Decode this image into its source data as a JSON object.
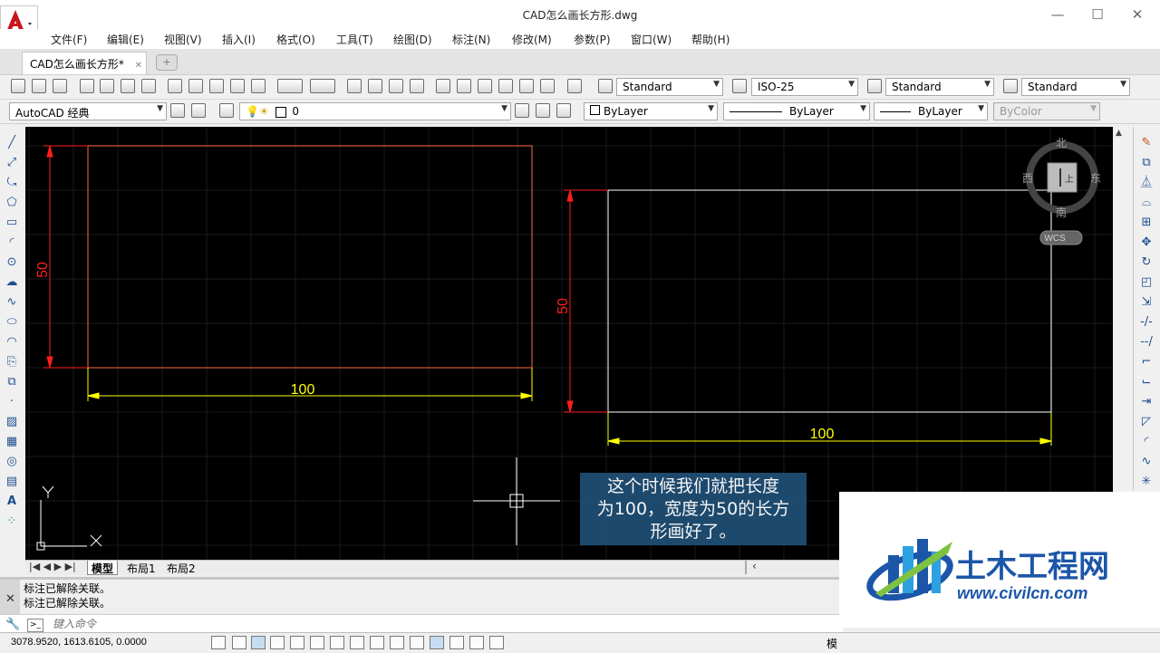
{
  "window": {
    "title": "CAD怎么画长方形.dwg",
    "minimize": "—",
    "maximize": "☐",
    "close": "✕"
  },
  "menu": [
    "文件(F)",
    "编辑(E)",
    "视图(V)",
    "插入(I)",
    "格式(O)",
    "工具(T)",
    "绘图(D)",
    "标注(N)",
    "修改(M)",
    "参数(P)",
    "窗口(W)",
    "帮助(H)"
  ],
  "doc_tab": {
    "label": "CAD怎么画长方形*",
    "close": "✕",
    "new_tab": "+"
  },
  "toolbar": {
    "text_style": "Standard",
    "dim_style": "ISO-25",
    "table_style": "Standard",
    "mleader_style": "Standard",
    "workspace": "AutoCAD 经典",
    "layer": "0",
    "color": "ByLayer",
    "linetype": "ByLayer",
    "lineweight": "ByLayer",
    "plotstyle": "ByColor"
  },
  "drawing": {
    "left_rect": {
      "width_dim": "100",
      "height_dim": "50"
    },
    "right_rect": {
      "width_dim": "100",
      "height_dim": "50"
    },
    "ucs": {
      "y_label": "Y",
      "x_label": "X"
    }
  },
  "viewcube": {
    "north": "北",
    "south": "南",
    "east": "东",
    "west": "西",
    "face": "上",
    "wcs": "WCS"
  },
  "layout_tabs": [
    "模型",
    "布局1",
    "布局2"
  ],
  "command": {
    "history": [
      "标注已解除关联。",
      "标注已解除关联。"
    ],
    "placeholder": "键入命令"
  },
  "status": {
    "coords": "3078.9520, 1613.6105, 0.0000",
    "model_label": "模"
  },
  "caption": {
    "lines": [
      "这个时候我们就把长度",
      "为100，宽度为50的长方",
      "形画好了。"
    ]
  },
  "watermark": {
    "name": "土木工程网",
    "url": "www.civilcn.com"
  },
  "colors": {
    "canvas_bg": "#000000",
    "rect_left": "#ff6a3a",
    "rect_right": "#ffffff",
    "dim_red": "#ff1e1e",
    "dim_yellow": "#ffff00",
    "caption_bg": "#1f4d72",
    "watermark_blue": "#1c56a8"
  }
}
